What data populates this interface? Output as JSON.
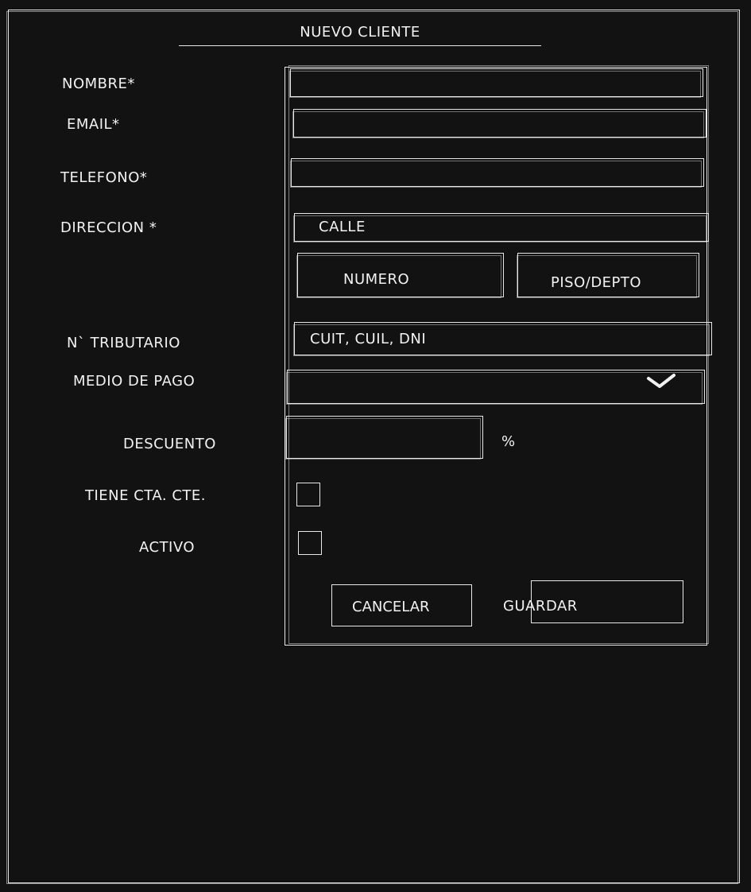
{
  "form": {
    "title": "NUEVO CLIENTE",
    "labels": {
      "nombre": "NOMBRE*",
      "email": "EMAIL*",
      "telefono": "TELEFONO*",
      "direccion": "DIRECCION *",
      "tributario": "N` TRIBUTARIO",
      "medio_pago": "MEDIO DE PAGO",
      "descuento": "DESCUENTO",
      "cta_cte": "TIENE CTA. CTE.",
      "activo": "ACTIVO"
    },
    "placeholders": {
      "calle": "CALLE",
      "numero": "NUMERO",
      "piso_depto": "PISO/DEPTO",
      "tributario": "CUIT, CUIL, DNI"
    },
    "percent_symbol": "%",
    "buttons": {
      "cancel": "CANCELAR",
      "save": "GUARDAR"
    }
  },
  "icons": {
    "dropdown": "chevron-down-icon"
  }
}
